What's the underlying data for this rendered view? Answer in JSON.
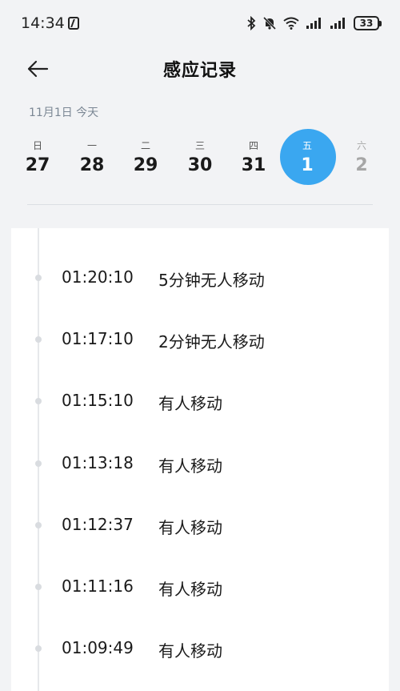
{
  "status_bar": {
    "time": "14:34",
    "battery": "33",
    "icons": [
      "nfc-icon",
      "bluetooth-icon",
      "mute-icon",
      "wifi-icon",
      "signal-icon",
      "signal-icon",
      "battery-icon"
    ]
  },
  "header": {
    "title": "感应记录",
    "back_icon": "back-arrow-icon"
  },
  "date_label": "11月1日 今天",
  "week": [
    {
      "weekday": "日",
      "day": "27",
      "state": "past"
    },
    {
      "weekday": "一",
      "day": "28",
      "state": "past"
    },
    {
      "weekday": "二",
      "day": "29",
      "state": "past"
    },
    {
      "weekday": "三",
      "day": "30",
      "state": "past"
    },
    {
      "weekday": "四",
      "day": "31",
      "state": "past"
    },
    {
      "weekday": "五",
      "day": "1",
      "state": "selected"
    },
    {
      "weekday": "六",
      "day": "2",
      "state": "future"
    }
  ],
  "records": [
    {
      "time": "01:20:10",
      "desc": "5分钟无人移动"
    },
    {
      "time": "01:17:10",
      "desc": "2分钟无人移动"
    },
    {
      "time": "01:15:10",
      "desc": "有人移动"
    },
    {
      "time": "01:13:18",
      "desc": "有人移动"
    },
    {
      "time": "01:12:37",
      "desc": "有人移动"
    },
    {
      "time": "01:11:16",
      "desc": "有人移动"
    },
    {
      "time": "01:09:49",
      "desc": "有人移动"
    }
  ],
  "colors": {
    "accent": "#3aa7f0",
    "background": "#f2f3f5",
    "card": "#ffffff",
    "muted": "#7b8794"
  }
}
